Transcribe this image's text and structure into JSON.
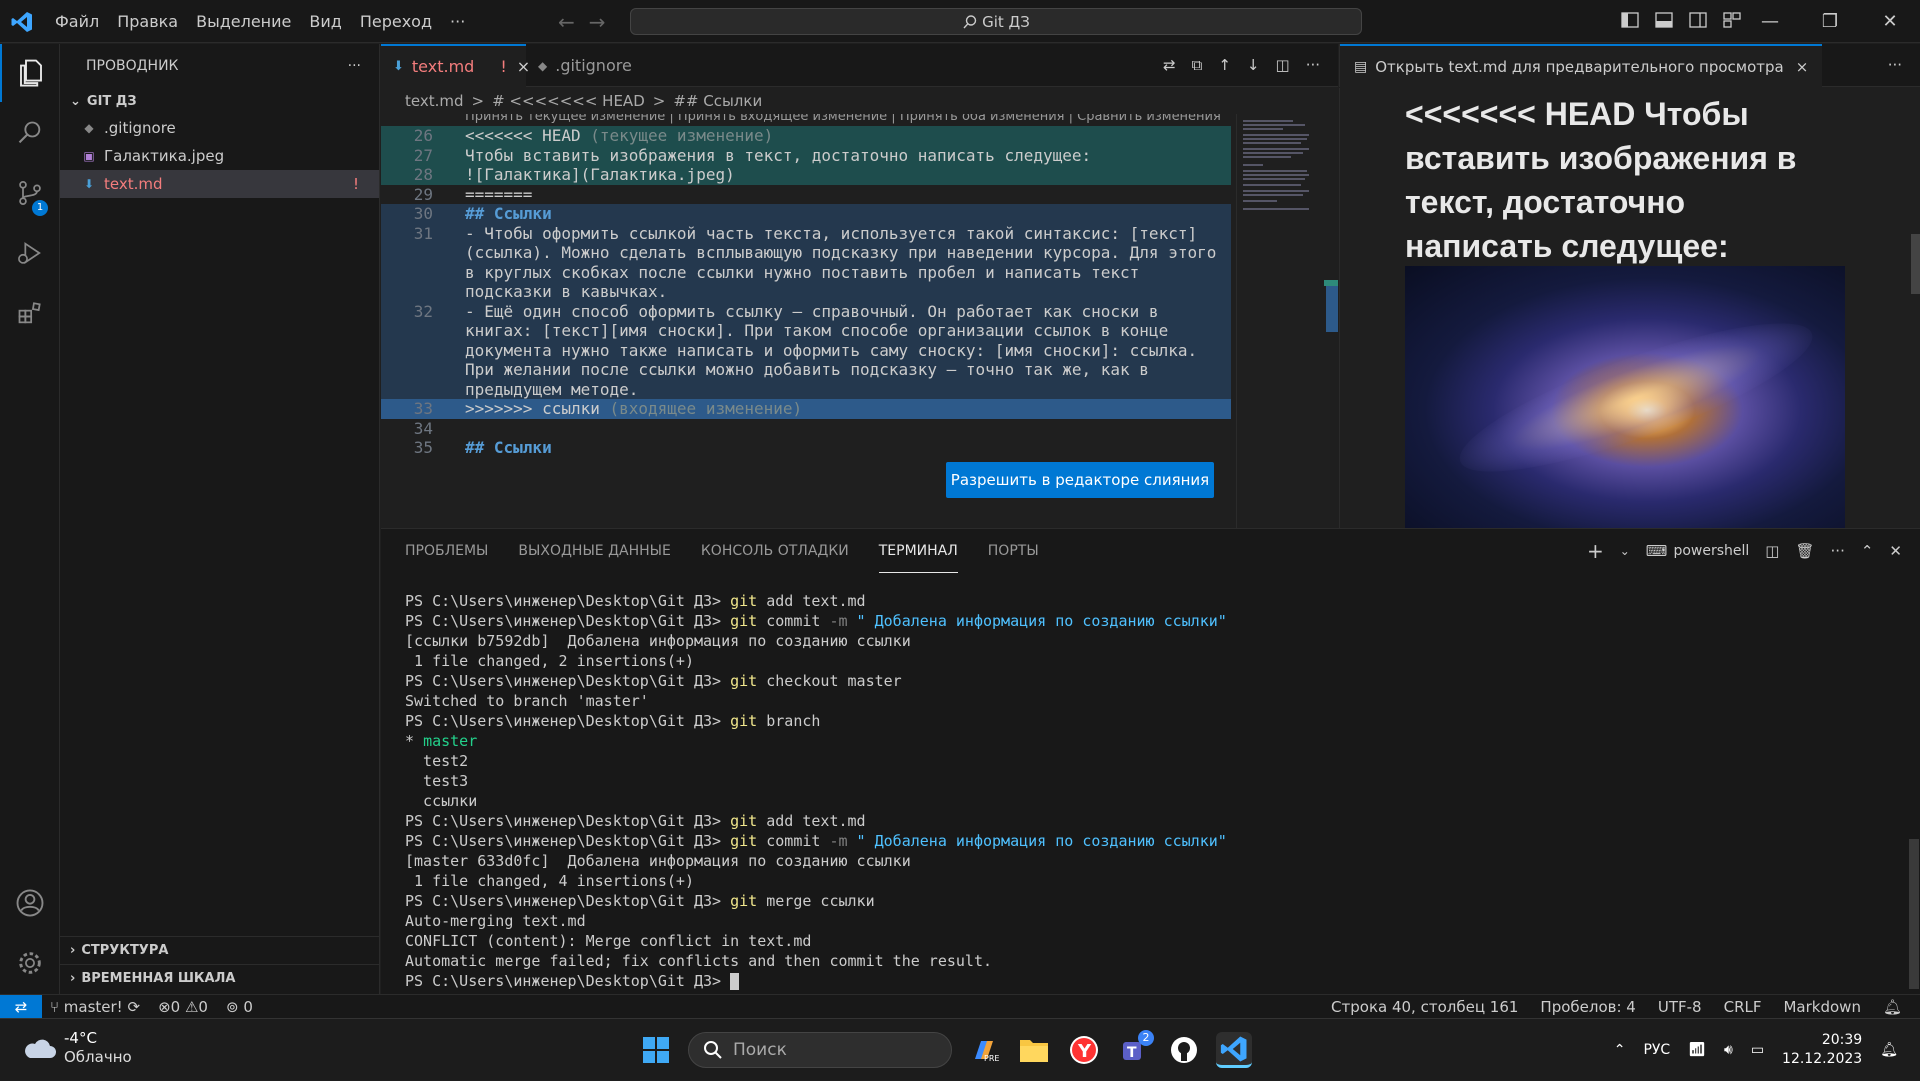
{
  "titlebar": {
    "menu": [
      "Файл",
      "Правка",
      "Выделение",
      "Вид",
      "Переход",
      "···"
    ],
    "search": "Git ДЗ"
  },
  "explorer": {
    "title": "ПРОВОДНИК",
    "more": "···",
    "folder": "GIT ДЗ",
    "files": [
      {
        "name": ".gitignore",
        "icon": "gitignore-icon"
      },
      {
        "name": "Галактика.jpeg",
        "icon": "image-file-icon"
      },
      {
        "name": "text.md",
        "icon": "markdown-file-icon",
        "mark": "!"
      }
    ],
    "sections": [
      "СТРУКТУРА",
      "ВРЕМЕННАЯ ШКАЛА"
    ]
  },
  "scm_badge": "1",
  "editor": {
    "tabs": [
      {
        "label": "text.md",
        "mark": "!",
        "close": "×"
      },
      {
        "label": ".gitignore"
      }
    ],
    "breadcrumb": [
      "text.md",
      ">",
      "# <<<<<<< HEAD",
      ">",
      "## Ссылки"
    ],
    "codelens": "Принять текущее изменение | Принять входящее изменение | Принять оба изменения | Сравнить изменения",
    "lines": [
      {
        "n": "26",
        "t": "<<<<<<< HEAD",
        "suffix": " (текущее изменение)",
        "k": "cur"
      },
      {
        "n": "27",
        "t": "Чтобы вставить изображения в текст, достаточно написать следущее:",
        "k": "cur"
      },
      {
        "n": "28",
        "t": "![Галактика](Галактика.jpeg)",
        "k": "cur"
      },
      {
        "n": "29",
        "t": "=======",
        "k": ""
      },
      {
        "n": "30",
        "t": "## Ссылки",
        "k": "inc",
        "h": true
      },
      {
        "n": "31",
        "t": "- Чтобы оформить ссылкой часть текста, используется такой синтаксис: [текст]",
        "k": "inc"
      },
      {
        "n": "",
        "t": "(ссылка). Можно сделать всплывающую подсказку при наведении курсора. Для этого",
        "k": "inc"
      },
      {
        "n": "",
        "t": "в круглых скобках после ссылки нужно поставить пробел и написать текст",
        "k": "inc"
      },
      {
        "n": "",
        "t": "подсказки в кавычках.",
        "k": "inc"
      },
      {
        "n": "32",
        "t": "- Ещё один способ оформить ссылку — справочный. Он работает как сноски в",
        "k": "inc"
      },
      {
        "n": "",
        "t": "книгах: [текст][имя сноски]. При таком способе организации ссылок в конце",
        "k": "inc"
      },
      {
        "n": "",
        "t": "документа нужно также написать и оформить саму сноску: [имя сноски]: ссылка.",
        "k": "inc"
      },
      {
        "n": "",
        "t": "При желании после ссылки можно добавить подсказку — точно так же, как в",
        "k": "inc"
      },
      {
        "n": "",
        "t": "предыдущем методе.",
        "k": "inc"
      },
      {
        "n": "33",
        "t": ">>>>>>> ссылки",
        "suffix": " (входящее изменение)",
        "k": "incmark"
      },
      {
        "n": "34",
        "t": "",
        "k": ""
      },
      {
        "n": "35",
        "t": "## Ссылки",
        "k": "",
        "h": true
      }
    ],
    "resolve_button": "Разрешить в редакторе слияния"
  },
  "preview": {
    "tab": "Открыть text.md для предварительного просмотра",
    "close": "×",
    "heading": "<<<<<<< HEAD Чтобы вставить изображения в текст, достаточно написать следущее:",
    "image_alt": "Галактика"
  },
  "panel": {
    "tabs": [
      "ПРОБЛЕМЫ",
      "ВЫХОДНЫЕ ДАННЫЕ",
      "КОНСОЛЬ ОТЛАДКИ",
      "ТЕРМИНАЛ",
      "ПОРТЫ"
    ],
    "active_tab": "ТЕРМИНАЛ",
    "shell": "powershell",
    "terminal": [
      {
        "p": "PS C:\\Users\\инженер\\Desktop\\Git ДЗ> ",
        "c": "git",
        "rest": " add text.md"
      },
      {
        "p": "PS C:\\Users\\инженер\\Desktop\\Git ДЗ> ",
        "c": "git",
        "rest": " commit ",
        "o": "-m",
        "s": " \" Добалена информация по созданию ссылки\""
      },
      {
        "plain": "[ссылки b7592db]  Добалена информация по созданию ссылки"
      },
      {
        "plain": " 1 file changed, 2 insertions(+)"
      },
      {
        "p": "PS C:\\Users\\инженер\\Desktop\\Git ДЗ> ",
        "c": "git",
        "rest": " checkout master"
      },
      {
        "plain": "Switched to branch 'master'"
      },
      {
        "p": "PS C:\\Users\\инженер\\Desktop\\Git ДЗ> ",
        "c": "git",
        "rest": " branch"
      },
      {
        "plain": "* ",
        "g": "master"
      },
      {
        "plain": "  test2"
      },
      {
        "plain": "  test3"
      },
      {
        "plain": "  ссылки"
      },
      {
        "p": "PS C:\\Users\\инженер\\Desktop\\Git ДЗ> ",
        "c": "git",
        "rest": " add text.md"
      },
      {
        "p": "PS C:\\Users\\инженер\\Desktop\\Git ДЗ> ",
        "c": "git",
        "rest": " commit ",
        "o": "-m",
        "s": " \" Добалена информация по созданию ссылки\""
      },
      {
        "plain": "[master 633d0fc]  Добалена информация по созданию ссылки"
      },
      {
        "plain": " 1 file changed, 4 insertions(+)"
      },
      {
        "p": "PS C:\\Users\\инженер\\Desktop\\Git ДЗ> ",
        "c": "git",
        "rest": " merge ссылки"
      },
      {
        "plain": "Auto-merging text.md"
      },
      {
        "plain": "CONFLICT (content): Merge conflict in text.md"
      },
      {
        "plain": "Automatic merge failed; fix conflicts and then commit the result."
      },
      {
        "p": "PS C:\\Users\\инженер\\Desktop\\Git ДЗ> ",
        "cursor": true
      }
    ]
  },
  "statusbar": {
    "branch": "master!",
    "errors": "0",
    "warnings": "0",
    "ports": "0",
    "position": "Строка 40, столбец 161",
    "spaces": "Пробелов: 4",
    "encoding": "UTF-8",
    "eol": "CRLF",
    "language": "Markdown"
  },
  "taskbar": {
    "temperature": "-4°C",
    "condition": "Облачно",
    "search_placeholder": "Поиск",
    "teams_badge": "2",
    "lang": "РУС",
    "time": "20:39",
    "date": "12.12.2023"
  },
  "colors": {
    "accent": "#0078d4",
    "conflict_current": "#1e4d4d",
    "conflict_incoming": "#24384e",
    "modified": "#f47d7d"
  }
}
